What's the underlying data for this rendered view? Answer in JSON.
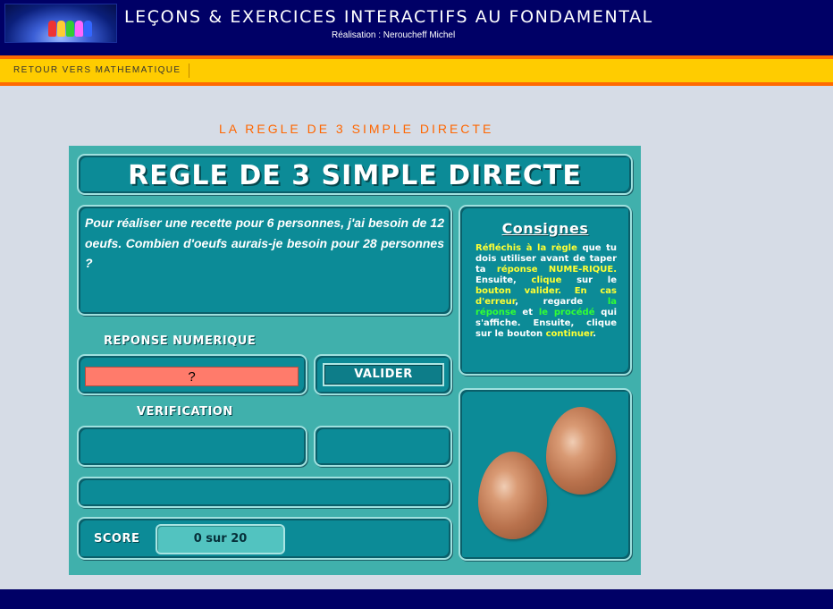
{
  "header": {
    "site_title": "LEÇONS & EXERCICES INTERACTIFS AU FONDAMENTAL",
    "credit": "Réalisation : Neroucheff Michel"
  },
  "nav": {
    "back_link": "RETOUR VERS MATHEMATIQUE"
  },
  "page": {
    "title": "LA REGLE DE 3 SIMPLE DIRECTE"
  },
  "exercise": {
    "banner": "REGLE DE 3 SIMPLE DIRECTE",
    "question": "Pour réaliser une recette pour 6 personnes, j'ai besoin de  12 oeufs. Combien d'oeufs aurais-je besoin pour 28 personnes ?",
    "answer_label": "REPONSE NUMERIQUE",
    "answer_value": "?",
    "validate_label": "VALIDER",
    "verification_label": "VERIFICATION",
    "score_label": "SCORE",
    "score_value": "0  sur 20"
  },
  "consignes": {
    "title": "Consignes",
    "parts": [
      "Réfléchis à la règle",
      " que tu dois utiliser avant de taper ta ",
      "réponse NUME-RIQUE.",
      " Ensuite, ",
      "clique",
      " sur le ",
      "bouton valider.",
      " ",
      "En cas d'erreur",
      ", regarde ",
      "la réponse",
      " et ",
      "le procédé",
      " qui s'affiche. Ensuite, clique sur le bouton ",
      "continuer",
      "."
    ]
  },
  "colors": {
    "header_bg": "#000066",
    "nav_bg": "#ffcc00",
    "accent_orange": "#ff6600",
    "app_bg": "#40b0ac",
    "panel_bg": "#0c8b97",
    "answer_bg": "#ff7b6b",
    "highlight_yellow": "#ffff33",
    "highlight_green": "#33ff33"
  }
}
